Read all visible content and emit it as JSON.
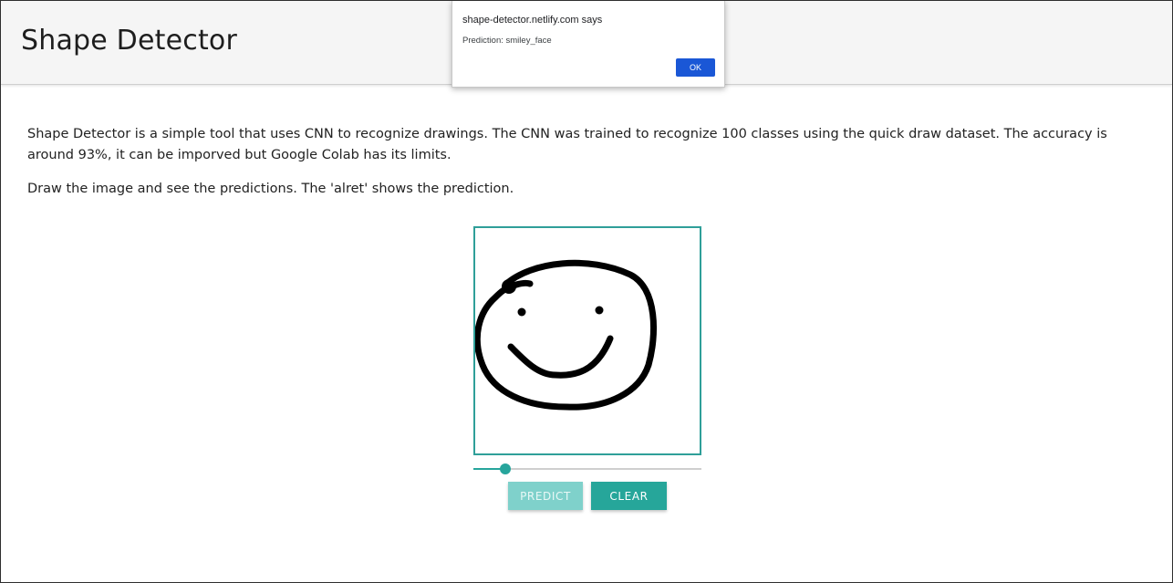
{
  "app": {
    "title": "Shape Detector"
  },
  "content": {
    "description": "Shape Detector is a simple tool that uses CNN to recognize drawings. The CNN was trained to recognize 100 classes using the quick draw dataset. The accuracy is around 93%, it can be imporved but Google Colab has its limits.",
    "instructions": "Draw the image and see the predictions. The 'alret' shows the prediction."
  },
  "drawing": {
    "stroke_color": "#000000",
    "border_color": "#2f9f99"
  },
  "slider": {
    "value_fraction": 0.14,
    "accent": "#27a59c"
  },
  "buttons": {
    "predict_label": "PREDICT",
    "clear_label": "CLEAR",
    "accent": "#26a69a"
  },
  "alert": {
    "title": "shape-detector.netlify.com says",
    "message": "Prediction: smiley_face",
    "ok_label": "OK",
    "ok_color": "#1a57d6"
  }
}
